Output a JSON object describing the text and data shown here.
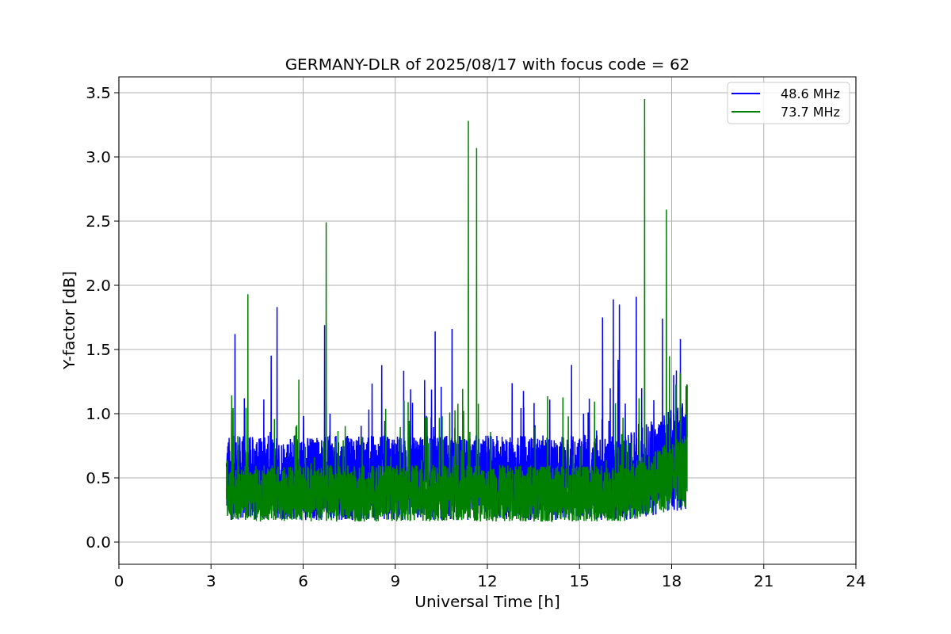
{
  "plot": {
    "title": "GERMANY-DLR of 2025/08/17 with focus code = 62",
    "xlabel": "Universal Time [h]",
    "ylabel": "Y-factor [dB]",
    "xticks": [
      "0",
      "3",
      "6",
      "9",
      "12",
      "15",
      "18",
      "21",
      "24"
    ],
    "yticks": [
      "3.5",
      "3.0",
      "2.5",
      "2.0",
      "1.5",
      "1.0",
      "0.5",
      "0.0"
    ],
    "legend": [
      {
        "label": "48.6 MHz",
        "color": "#0000ff"
      },
      {
        "label": "73.7 MHz",
        "color": "#008000"
      }
    ]
  }
}
